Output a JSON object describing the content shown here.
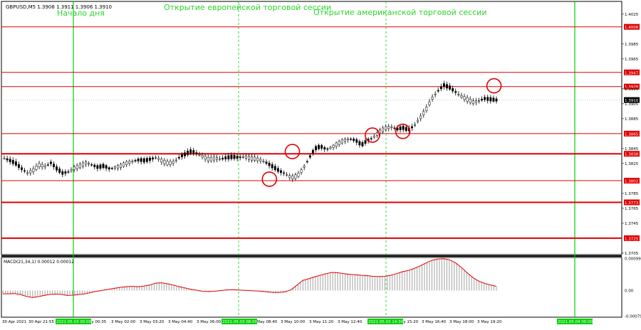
{
  "chart_data": {
    "type": "candlestick",
    "header": "GBPUSD,M5  1.3908 1.3911 1.3906 1.3910",
    "annotations": {
      "day_start": "Начало дня",
      "europe_open": "Открытие европейской торговой сессии",
      "us_open": "Открытие американской торговой сессии"
    },
    "price_scale": {
      "ylim": [
        1.3703,
        1.4042
      ],
      "ticks": [
        "1.4025",
        "1.3985",
        "1.3965",
        "1.3925",
        "1.3905",
        "1.3885",
        "1.3845",
        "1.3825",
        "1.3785",
        "1.3765",
        "1.3745",
        "1.3705"
      ],
      "current": "1.3910"
    },
    "levels": [
      {
        "value": 1.4008,
        "label": "1.4008",
        "bold": false
      },
      {
        "value": 1.3947,
        "label": "1.3947",
        "bold": false
      },
      {
        "value": 1.3928,
        "label": "1.3928",
        "bold": false
      },
      {
        "value": 1.3865,
        "label": "1.3865",
        "bold": false
      },
      {
        "value": 1.3838,
        "label": "1.3838",
        "bold": true
      },
      {
        "value": 1.3802,
        "label": "1.3802",
        "bold": false
      },
      {
        "value": 1.3773,
        "label": "1.3773",
        "bold": true
      },
      {
        "value": 1.3725,
        "label": "1.3725",
        "bold": true
      }
    ],
    "time_axis": {
      "labels": [
        "30 Apr 2021",
        "30 Apr 21:55",
        "3 May 00:35",
        "3 May 02:00",
        "3 May 03:20",
        "3 May 04:40",
        "3 May 06:00",
        "3 May 08:40",
        "3 May 10:00",
        "3 May 11:20",
        "3 May 12:40",
        "3 May 15:20",
        "3 May 16:40",
        "3 May 18:00",
        "3 May 19:20"
      ],
      "highlighted": [
        "2021.05.03 00:00",
        "2021.05.03 08:00",
        "2021.05.03 14:30",
        "2021.05.04 00:00"
      ]
    },
    "price_series": [
      1.3832,
      1.3829,
      1.3825,
      1.3818,
      1.3812,
      1.3816,
      1.3823,
      1.3821,
      1.3826,
      1.3818,
      1.3812,
      1.3814,
      1.3819,
      1.3822,
      1.3826,
      1.3823,
      1.382,
      1.3822,
      1.3818,
      1.382,
      1.3822,
      1.3826,
      1.3828,
      1.383,
      1.3829,
      1.3831,
      1.3833,
      1.3828,
      1.3825,
      1.3827,
      1.3834,
      1.3838,
      1.3842,
      1.3838,
      1.3834,
      1.383,
      1.3832,
      1.3831,
      1.3833,
      1.3834,
      1.3833,
      1.3834,
      1.3832,
      1.3831,
      1.3829,
      1.3825,
      1.382,
      1.3815,
      1.3811,
      1.3806,
      1.3808,
      1.3818,
      1.3832,
      1.3845,
      1.3848,
      1.3844,
      1.3847,
      1.3852,
      1.3856,
      1.3858,
      1.3856,
      1.385,
      1.3856,
      1.386,
      1.3867,
      1.3872,
      1.3874,
      1.3871,
      1.3873,
      1.387,
      1.3876,
      1.3886,
      1.3897,
      1.3912,
      1.3922,
      1.393,
      1.3927,
      1.3921,
      1.3915,
      1.3911,
      1.3907,
      1.3909,
      1.3912,
      1.3911,
      1.391
    ],
    "circled_points": [
      [
        1.3804,
        0.432
      ],
      [
        1.3841,
        0.469
      ],
      [
        1.3863,
        0.598
      ],
      [
        1.3868,
        0.647
      ],
      [
        1.3929,
        0.794
      ]
    ],
    "macd": {
      "label": "MACD(21,34,1) 0.00012 0.00012",
      "ticks": [
        "0.00099",
        "0.00",
        "-0.00079"
      ],
      "ylim": [
        -0.00082,
        0.00102
      ],
      "signal": [
        -0.0001,
        -0.0001,
        -9e-05,
        -0.00012,
        -0.00018,
        -0.00021,
        -0.00019,
        -0.00015,
        -0.00012,
        -0.00011,
        -0.00012,
        -0.00015,
        -0.00014,
        -0.00012,
        -0.0001,
        -6e-05,
        -2e-05,
        1e-05,
        4e-05,
        7e-05,
        0.0001,
        0.00012,
        0.00013,
        0.00012,
        0.00014,
        0.00017,
        0.00023,
        0.00024,
        0.00021,
        0.00017,
        0.00012,
        8e-05,
        4e-05,
        1e-05,
        -2e-05,
        -3e-05,
        -2e-05,
        0.0,
        2e-05,
        3e-05,
        2e-05,
        1e-05,
        0.0,
        -1e-05,
        -2e-05,
        -4e-05,
        -6e-05,
        -6e-05,
        -4e-05,
        2e-05,
        0.00016,
        0.00031,
        0.00036,
        0.00042,
        0.00047,
        0.00052,
        0.00056,
        0.00055,
        0.00052,
        0.0005,
        0.00049,
        0.00047,
        0.00046,
        0.00044,
        0.00043,
        0.00044,
        0.00047,
        0.00052,
        0.00058,
        0.00062,
        0.00068,
        0.00076,
        0.00085,
        0.00093,
        0.00097,
        0.00098,
        0.00095,
        0.00086,
        0.00072,
        0.00055,
        0.0004,
        0.00029,
        0.00022,
        0.00017,
        0.00013
      ]
    }
  },
  "colors": {
    "background": "#ffffff",
    "level_line": "#e00000",
    "session_line": "#00d000",
    "candle": "#000000",
    "macd_hist": "#a0a0a0",
    "macd_signal": "#e00000",
    "annotation_text": "#2bd62b"
  }
}
